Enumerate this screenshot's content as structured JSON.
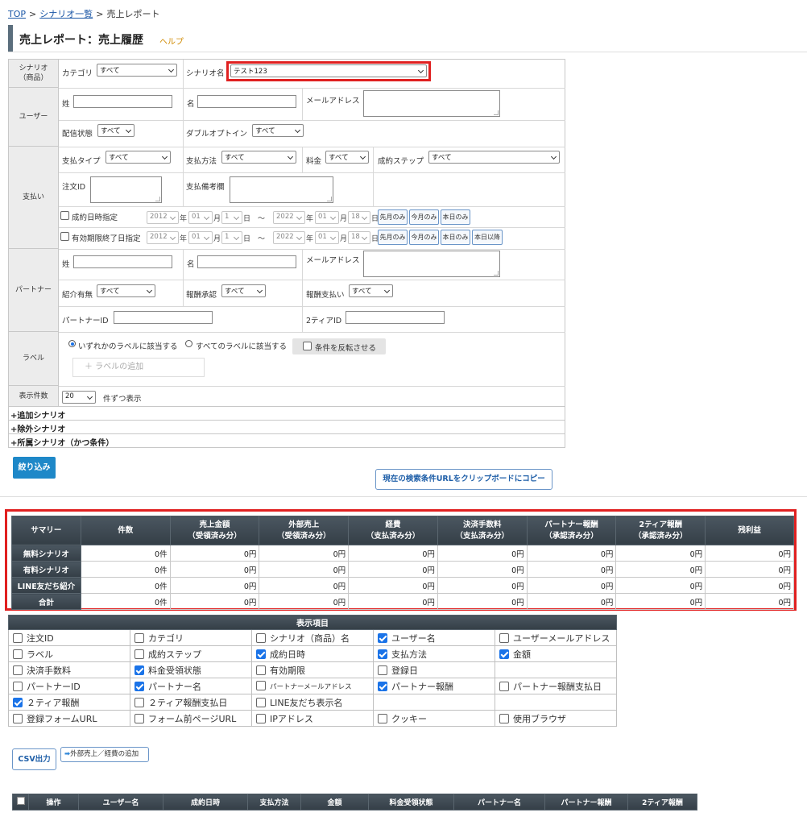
{
  "breadcrumb": {
    "items": [
      "TOP",
      "シナリオ一覧"
    ],
    "current": "売上レポート",
    "separator": ">"
  },
  "page": {
    "title": "売上レポート：売上履歴",
    "help_label": "ヘルプ"
  },
  "filters": {
    "scenario": {
      "header_l1": "シナリオ",
      "header_l2": "（商品）",
      "category_label": "カテゴリ",
      "category_value": "すべて",
      "name_label": "シナリオ名",
      "name_value": "テスト123"
    },
    "user": {
      "header": "ユーザー",
      "last_name": "姓",
      "first_name": "名",
      "email": "メールアドレス",
      "delivery_label": "配信状態",
      "delivery_value": "すべて",
      "optin_label": "ダブルオプトイン",
      "optin_value": "すべて"
    },
    "payment": {
      "header": "支払い",
      "type_label": "支払タイプ",
      "type_value": "すべて",
      "method_label": "支払方法",
      "method_value": "すべて",
      "fee_label": "料金",
      "fee_value": "すべて",
      "step_label": "成約ステップ",
      "step_value": "すべて",
      "order_id_label": "注文ID",
      "memo_label": "支払備考欄",
      "date_label": "成約日時指定",
      "expire_label": "有効期限終了日指定",
      "from": {
        "year": "2012",
        "month": "01",
        "day": "1"
      },
      "to": {
        "year": "2022",
        "month": "01",
        "day": "18"
      },
      "year_unit": "年",
      "month_unit": "月",
      "day_unit": "日",
      "tilde": "～",
      "btn_last_month": "先月のみ",
      "btn_this_month": "今月のみ",
      "btn_today": "本日のみ",
      "btn_after_today": "本日以降"
    },
    "partner": {
      "header": "パートナー",
      "last_name": "姓",
      "first_name": "名",
      "email": "メールアドレス",
      "referral_label": "紹介有無",
      "referral_value": "すべて",
      "reward_approve_label": "報酬承認",
      "reward_approve_value": "すべて",
      "reward_pay_label": "報酬支払い",
      "reward_pay_value": "すべて",
      "partner_id_label": "パートナーID",
      "tier2_id_label": "2ティアID"
    },
    "label": {
      "header": "ラベル",
      "any_label": "いずれかのラベルに該当する",
      "all_label": "すべてのラベルに該当する",
      "invert_label": "条件を反転させる",
      "add_placeholder": "＋ ラベルの追加"
    },
    "display_count": {
      "header": "表示件数",
      "value": "20",
      "suffix": "件ずつ表示"
    },
    "folds": [
      "+追加シナリオ",
      "+除外シナリオ",
      "+所属シナリオ（かつ条件）"
    ]
  },
  "actions": {
    "filter_button": "絞り込み",
    "copy_url_button": "現在の検索条件URLをクリップボードにコピー",
    "csv_button": "CSV出力",
    "external_button": "外部売上／経費の追加"
  },
  "summary": {
    "headers": [
      {
        "l1": "サマリー",
        "l2": ""
      },
      {
        "l1": "件数",
        "l2": ""
      },
      {
        "l1": "売上金額",
        "l2": "（受領済み分）"
      },
      {
        "l1": "外部売上",
        "l2": "（受領済み分）"
      },
      {
        "l1": "経費",
        "l2": "（支払済み分）"
      },
      {
        "l1": "決済手数料",
        "l2": "（支払済み分）"
      },
      {
        "l1": "パートナー報酬",
        "l2": "（承認済み分）"
      },
      {
        "l1": "2ティア報酬",
        "l2": "（承認済み分）"
      },
      {
        "l1": "残利益",
        "l2": ""
      }
    ],
    "rows": [
      {
        "label": "無料シナリオ",
        "values": [
          "0件",
          "0円",
          "0円",
          "0円",
          "0円",
          "0円",
          "0円",
          "0円"
        ]
      },
      {
        "label": "有料シナリオ",
        "values": [
          "0件",
          "0円",
          "0円",
          "0円",
          "0円",
          "0円",
          "0円",
          "0円"
        ]
      },
      {
        "label": "LINE友だち紹介",
        "values": [
          "0件",
          "0円",
          "0円",
          "0円",
          "0円",
          "0円",
          "0円",
          "0円"
        ]
      },
      {
        "label": "合計",
        "values": [
          "0件",
          "0円",
          "0円",
          "0円",
          "0円",
          "0円",
          "0円",
          "0円"
        ]
      }
    ]
  },
  "display_items": {
    "title": "表示項目",
    "rows": [
      [
        {
          "label": "注文ID",
          "checked": false
        },
        {
          "label": "カテゴリ",
          "checked": false
        },
        {
          "label": "シナリオ（商品）名",
          "checked": false
        },
        {
          "label": "ユーザー名",
          "checked": true
        },
        {
          "label": "ユーザーメールアドレス",
          "checked": false
        }
      ],
      [
        {
          "label": "ラベル",
          "checked": false
        },
        {
          "label": "成約ステップ",
          "checked": false
        },
        {
          "label": "成約日時",
          "checked": true
        },
        {
          "label": "支払方法",
          "checked": true
        },
        {
          "label": "金額",
          "checked": true
        }
      ],
      [
        {
          "label": "決済手数料",
          "checked": false
        },
        {
          "label": "料金受領状態",
          "checked": true
        },
        {
          "label": "有効期限",
          "checked": false
        },
        {
          "label": "登録日",
          "checked": false
        },
        null
      ],
      [
        {
          "label": "パートナーID",
          "checked": false
        },
        {
          "label": "パートナー名",
          "checked": true
        },
        {
          "label": "パートナーメールアドレス",
          "checked": false,
          "small": true
        },
        {
          "label": "パートナー報酬",
          "checked": true
        },
        {
          "label": "パートナー報酬支払日",
          "checked": false
        }
      ],
      [
        {
          "label": "２ティア報酬",
          "checked": true
        },
        {
          "label": "２ティア報酬支払日",
          "checked": false
        },
        {
          "label": "LINE友だち表示名",
          "checked": false
        },
        null,
        null
      ],
      [
        {
          "label": "登録フォームURL",
          "checked": false
        },
        {
          "label": "フォーム前ページURL",
          "checked": false
        },
        {
          "label": "IPアドレス",
          "checked": false
        },
        {
          "label": "クッキー",
          "checked": false
        },
        {
          "label": "使用ブラウザ",
          "checked": false
        }
      ]
    ]
  },
  "results": {
    "headers": [
      "",
      "操作",
      "ユーザー名",
      "成約日時",
      "支払方法",
      "金額",
      "料金受領状態",
      "パートナー名",
      "パートナー報酬",
      "2ティア報酬"
    ]
  },
  "colors": {
    "accent_blue": "#1e88c8",
    "highlight_red": "#e02020",
    "header_dark": "#3a454e",
    "help_orange": "#d08a00"
  }
}
